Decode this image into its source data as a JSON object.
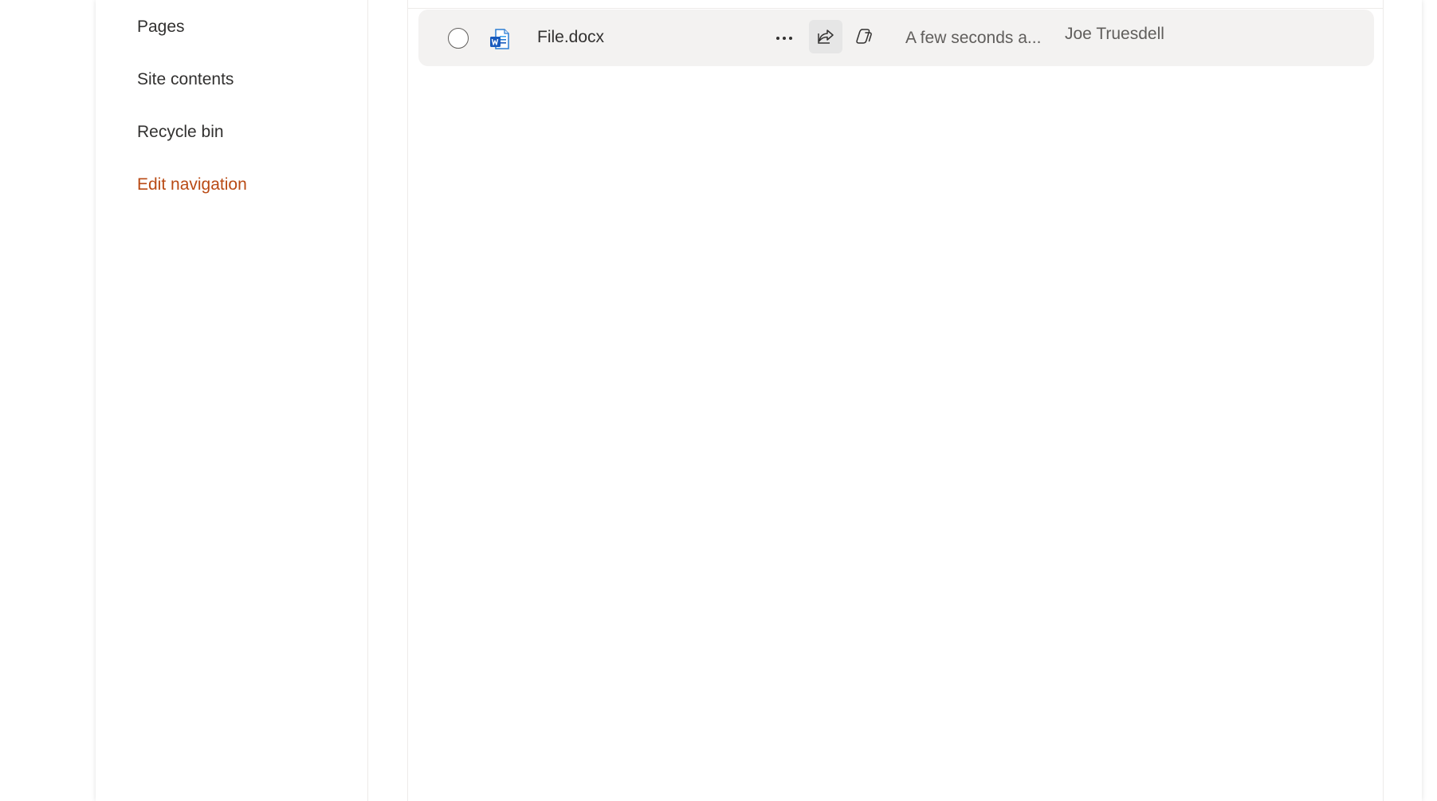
{
  "nav": {
    "items": [
      {
        "label": "Pages"
      },
      {
        "label": "Site contents"
      },
      {
        "label": "Recycle bin"
      }
    ],
    "edit_label": "Edit navigation",
    "accent_color": "#b94a14"
  },
  "file_row": {
    "name": "File.docx",
    "file_type_icon": "word-icon",
    "modified": "A few seconds a...",
    "modified_by": "Joe Truesdell",
    "actions": [
      "more-options-icon",
      "share-icon",
      "copilot-icon"
    ]
  }
}
